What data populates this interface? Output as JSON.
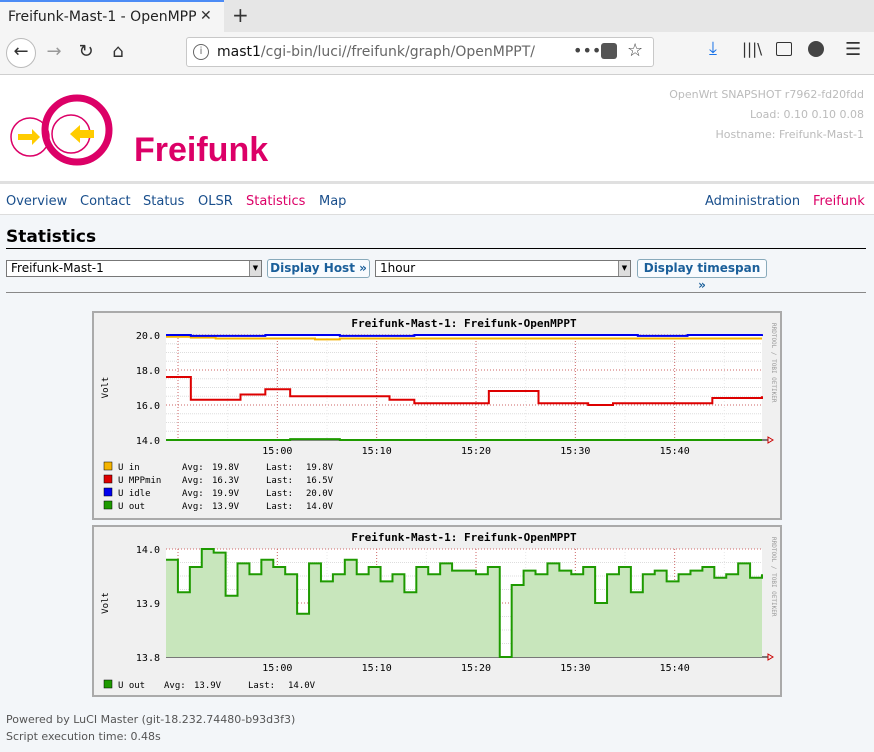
{
  "browser": {
    "tab_title": "Freifunk-Mast-1 - OpenMPPT",
    "close_glyph": "✕",
    "newtab_glyph": "+",
    "url_host": "mast1",
    "url_path": "/cgi-bin/luci//freifunk/graph/OpenMPPT/",
    "url_more": "•••"
  },
  "header": {
    "brand": "Freifunk",
    "system": "OpenWrt SNAPSHOT r7962-fd20fdd",
    "load": "Load: 0.10 0.10 0.08",
    "hostname": "Hostname: Freifunk-Mast-1"
  },
  "menu": {
    "overview": "Overview",
    "contact": "Contact",
    "status": "Status",
    "olsr": "OLSR",
    "statistics": "Statistics",
    "map": "Map",
    "administration": "Administration",
    "freifunk": "Freifunk"
  },
  "page": {
    "title": "Statistics",
    "host_select": "Freifunk-Mast-1",
    "host_button": "Display Host »",
    "timespan_select": "1hour",
    "timespan_button": "Display timespan »"
  },
  "chart_data": [
    {
      "type": "line",
      "title": "Freifunk-Mast-1: Freifunk-OpenMPPT",
      "ylabel": "Volt",
      "side_label": "RRDTOOL / TOBI OETIKER",
      "ylim": [
        14.0,
        20.0
      ],
      "yticks": [
        "20.0",
        "18.0",
        "16.0",
        "14.0"
      ],
      "xticks": [
        "15:00",
        "15:10",
        "15:20",
        "15:30",
        "15:40"
      ],
      "series": [
        {
          "name": "U in",
          "color": "#f5b400",
          "avg": "19.8V",
          "last": "19.8V",
          "values": [
            19.9,
            19.85,
            19.8,
            19.8,
            19.8,
            19.8,
            19.75,
            19.8,
            19.8,
            19.8,
            19.8,
            19.8,
            19.8,
            19.8,
            19.8,
            19.8,
            19.8,
            19.8,
            19.8,
            19.8,
            19.8,
            19.8,
            19.8,
            19.8,
            19.8
          ]
        },
        {
          "name": "U MPPmin",
          "color": "#dd0000",
          "avg": "16.3V",
          "last": "16.5V",
          "values": [
            17.6,
            16.3,
            16.3,
            16.6,
            16.9,
            16.5,
            16.5,
            16.5,
            16.5,
            16.3,
            16.1,
            16.1,
            16.1,
            16.8,
            16.8,
            16.1,
            16.1,
            16.0,
            16.1,
            16.1,
            16.1,
            16.1,
            16.4,
            16.4,
            16.5
          ]
        },
        {
          "name": "U idle",
          "color": "#0000ee",
          "avg": "19.9V",
          "last": "20.0V",
          "values": [
            20.0,
            19.95,
            19.95,
            19.95,
            20.0,
            20.0,
            20.0,
            19.95,
            19.95,
            19.95,
            20.0,
            20.0,
            20.0,
            20.0,
            20.0,
            20.0,
            20.0,
            20.0,
            20.0,
            19.95,
            19.95,
            20.0,
            20.0,
            20.0,
            20.05
          ]
        },
        {
          "name": "U out",
          "color": "#1e9a00",
          "avg": "13.9V",
          "last": "14.0V",
          "values": [
            14.0,
            13.95,
            13.95,
            14.0,
            14.0,
            14.05,
            14.05,
            14.0,
            14.0,
            14.0,
            14.0,
            14.0,
            14.0,
            14.0,
            13.95,
            14.0,
            14.0,
            14.0,
            14.0,
            13.95,
            14.0,
            14.0,
            14.0,
            14.0,
            14.0
          ]
        }
      ]
    },
    {
      "type": "area",
      "title": "Freifunk-Mast-1: Freifunk-OpenMPPT",
      "ylabel": "Volt",
      "side_label": "RRDTOOL / TOBI OETIKER",
      "ylim": [
        13.7,
        14.0
      ],
      "yticks": [
        "14.0",
        "13.9",
        "13.8"
      ],
      "xticks": [
        "15:00",
        "15:10",
        "15:20",
        "15:30",
        "15:40"
      ],
      "series": [
        {
          "name": "U out",
          "color": "#1e9a00",
          "fill": "#c8e6bc",
          "avg": "13.9V",
          "last": "14.0V",
          "values": [
            13.97,
            13.88,
            13.95,
            14.0,
            13.99,
            13.87,
            13.96,
            13.93,
            13.97,
            13.95,
            13.93,
            13.82,
            13.96,
            13.91,
            13.93,
            13.97,
            13.93,
            13.95,
            13.91,
            13.93,
            13.88,
            13.95,
            13.93,
            13.96,
            13.94,
            13.94,
            13.93,
            13.95,
            13.7,
            13.9,
            13.94,
            13.93,
            13.96,
            13.94,
            13.93,
            13.95,
            13.85,
            13.93,
            13.95,
            13.88,
            13.93,
            13.94,
            13.91,
            13.93,
            13.94,
            13.95,
            13.92,
            13.93,
            13.96,
            13.92,
            13.93
          ]
        }
      ]
    }
  ],
  "footer": {
    "powered": "Powered by LuCI Master (git-18.232.74480-b93d3f3)",
    "exec_time": "Script execution time: 0.48s"
  }
}
